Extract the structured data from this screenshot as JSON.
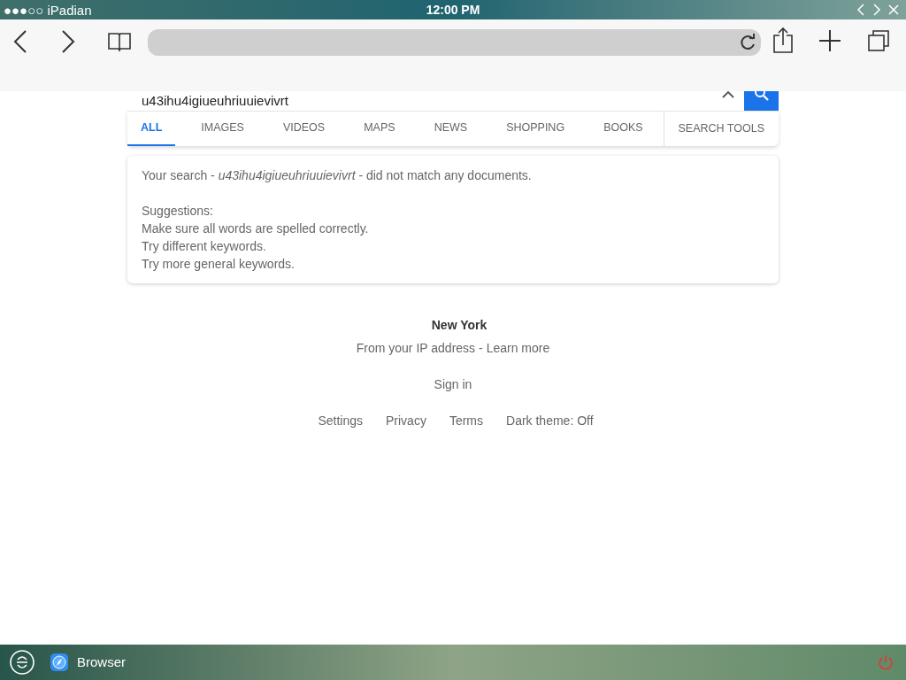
{
  "status_bar": {
    "carrier": "●●●○○ iPadian",
    "time": "12:00 PM"
  },
  "search": {
    "value": "u43ihu4igiueuhriuuievivrt"
  },
  "tabs": [
    {
      "label": "ALL",
      "selected": true
    },
    {
      "label": "IMAGES",
      "selected": false
    },
    {
      "label": "VIDEOS",
      "selected": false
    },
    {
      "label": "MAPS",
      "selected": false
    },
    {
      "label": "NEWS",
      "selected": false
    },
    {
      "label": "SHOPPING",
      "selected": false
    },
    {
      "label": "BOOKS",
      "selected": false
    }
  ],
  "search_tools": "SEARCH TOOLS",
  "result": {
    "message": "Your search - *u43ihu4igiueuhriuuievivrt* - did not match any documents.",
    "suggestions_title": "Suggestions:",
    "suggestions": [
      "Make sure all words are spelled correctly.",
      "Try different keywords.",
      "Try more general keywords."
    ]
  },
  "footer": {
    "location": "New York",
    "ip_note": "From your IP address -",
    "learn_more": "Learn more",
    "sign_in": "Sign in",
    "links": [
      "Settings",
      "Privacy",
      "Terms",
      "Dark theme: Off"
    ]
  },
  "taskbar": {
    "app": "Browser"
  }
}
